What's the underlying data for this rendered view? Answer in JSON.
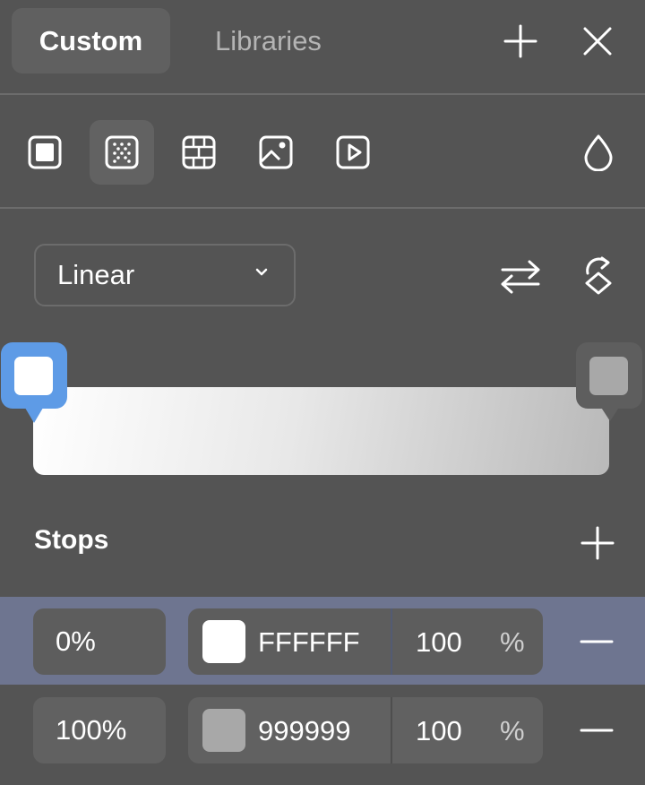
{
  "tabs": {
    "active_label": "Custom",
    "other_label": "Libraries"
  },
  "fill_types": [
    "solid",
    "gradient",
    "pattern",
    "image",
    "video"
  ],
  "gradient": {
    "type_label": "Linear",
    "start_color": "#FFFFFF",
    "end_color": "#999999"
  },
  "stops": {
    "title": "Stops",
    "items": [
      {
        "position": "0%",
        "swatch": "#ffffff",
        "hex": "FFFFFF",
        "opacity": "100",
        "unit": "%"
      },
      {
        "position": "100%",
        "swatch": "#a8a8a8",
        "hex": "999999",
        "opacity": "100",
        "unit": "%"
      }
    ]
  },
  "colors": {
    "accent": "#5e9be6",
    "panel_bg": "#545454",
    "selected_row": "#6e7590"
  }
}
